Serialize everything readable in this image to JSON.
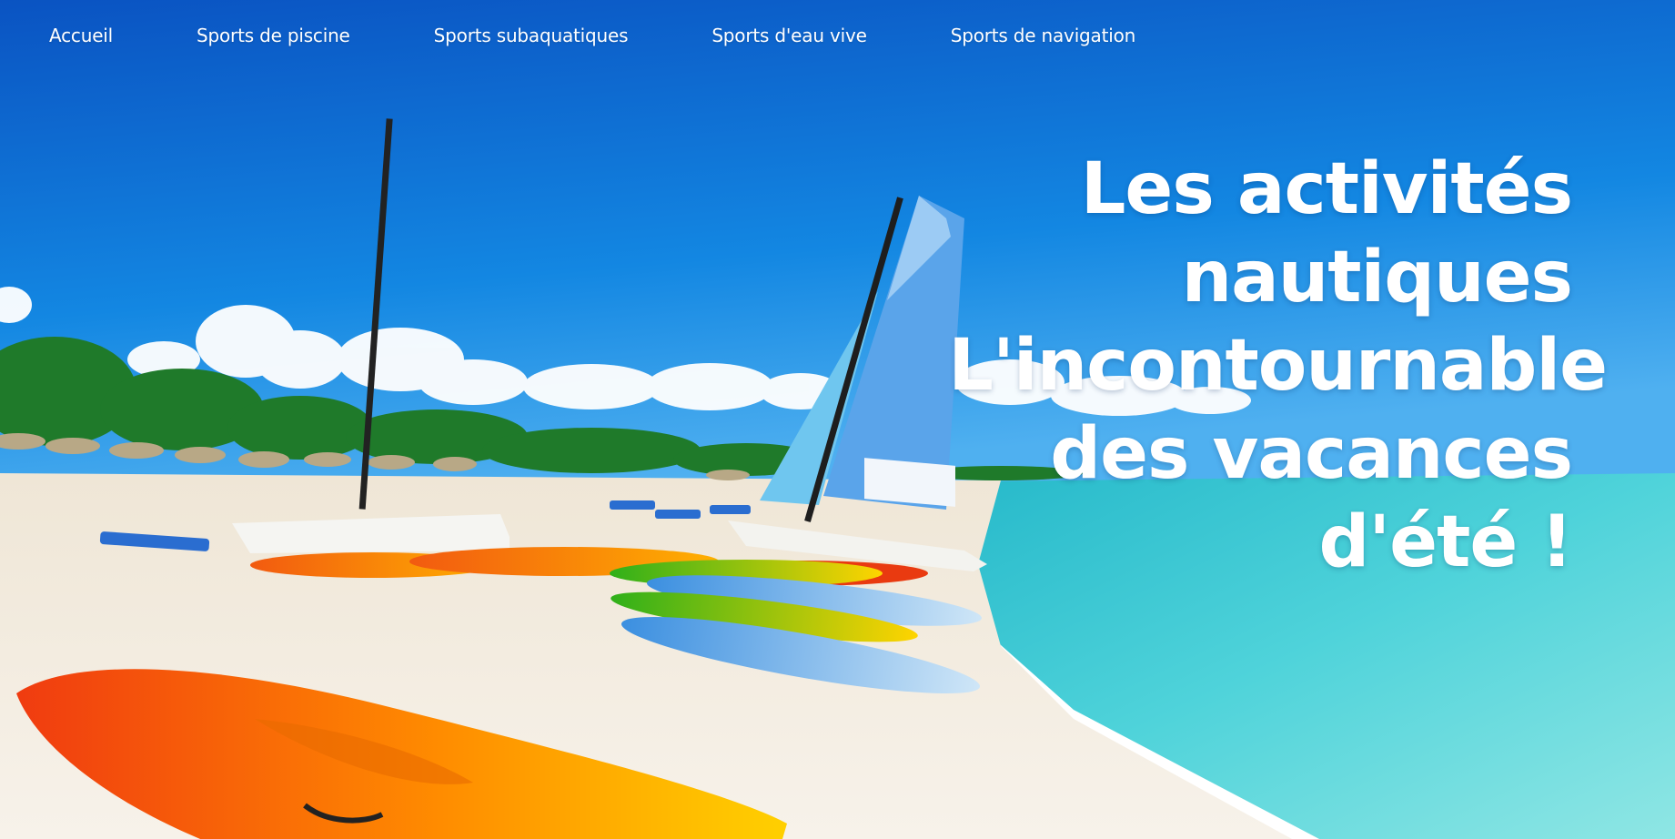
{
  "nav": {
    "items": [
      {
        "label": "Accueil"
      },
      {
        "label": "Sports de piscine"
      },
      {
        "label": "Sports subaquatiques"
      },
      {
        "label": "Sports d'eau vive"
      },
      {
        "label": "Sports de navigation"
      }
    ]
  },
  "hero": {
    "headline_lines": [
      "Les activités",
      "nautiques",
      "L'incontournable",
      "des vacances",
      "d'été !"
    ]
  },
  "colors": {
    "sky_top": "#0a56c4",
    "sky_mid": "#1a86e0",
    "sea": "#3fcfd8",
    "sand": "#f3ede2",
    "text": "#ffffff"
  }
}
